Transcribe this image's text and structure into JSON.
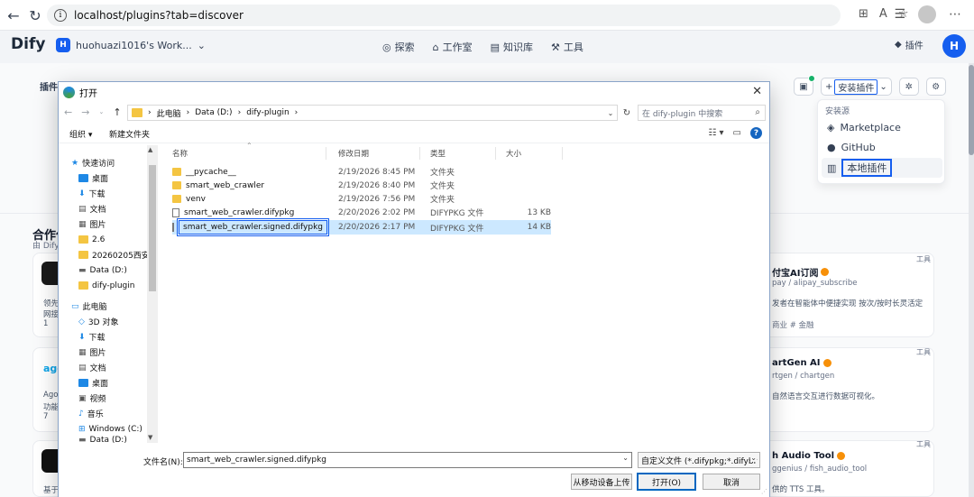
{
  "browser": {
    "url": "localhost/plugins?tab=discover"
  },
  "app": {
    "logo": "Dify",
    "workspace_badge": "H",
    "workspace_name": "huohuazi1016's Work...",
    "nav": [
      "探索",
      "工作室",
      "知识库",
      "工具"
    ],
    "plugins_label": "插件",
    "user_initial": "H"
  },
  "background_page": {
    "tab_label_partial": "插件",
    "install_button_label": "安装插件",
    "install_menu": {
      "header": "安装源",
      "items": [
        "Marketplace",
        "GitHub",
        "本地插件"
      ]
    },
    "section_title": "合作伙",
    "section_sub": "由 Dify",
    "cards_right": [
      {
        "title": "付宝AI订阅",
        "sub": "pay / alipay_subscribe",
        "desc": "发者在智能体中便捷实现 按次/按时长灵活定",
        "tags": "商业  # 金融",
        "tag": "工具"
      },
      {
        "title": "artGen AI",
        "sub": "rtgen / chartgen",
        "desc": "自然语言交互进行数据可视化。",
        "tags": "",
        "tag": "工具"
      },
      {
        "title": "h Audio Tool",
        "sub": "ggenius / fish_audio_tool",
        "desc": "供的 TTS 工具。",
        "tags": "",
        "tag": "工具"
      }
    ],
    "cards_left": [
      {
        "desc1": "领先",
        "desc2": "网接",
        "meta": "1"
      },
      {
        "logo_text": "ago",
        "desc1": "Ago",
        "desc2": "功能",
        "meta": "7"
      },
      {
        "desc1": "基于"
      }
    ]
  },
  "dialog": {
    "title": "打开",
    "breadcrumb": [
      "此电脑",
      "Data (D:)",
      "dify-plugin"
    ],
    "search_placeholder": "在 dify-plugin 中搜索",
    "organize": "组织 ▾",
    "new_folder": "新建文件夹",
    "nav_items": [
      {
        "label": "快速访问",
        "icon": "star",
        "pinned": false
      },
      {
        "label": "桌面",
        "icon": "desktop",
        "pinned": true
      },
      {
        "label": "下载",
        "icon": "download",
        "pinned": true
      },
      {
        "label": "文档",
        "icon": "document",
        "pinned": true
      },
      {
        "label": "图片",
        "icon": "picture",
        "pinned": true
      },
      {
        "label": "2.6",
        "icon": "folder",
        "pinned": false
      },
      {
        "label": "20260205西安§",
        "icon": "folder",
        "pinned": false
      },
      {
        "label": "Data (D:)",
        "icon": "drive",
        "pinned": false
      },
      {
        "label": "dify-plugin",
        "icon": "folder",
        "pinned": false
      },
      {
        "label": "此电脑",
        "icon": "pc",
        "pinned": false
      },
      {
        "label": "3D 对象",
        "icon": "3d",
        "pinned": false
      },
      {
        "label": "下载",
        "icon": "download",
        "pinned": false
      },
      {
        "label": "图片",
        "icon": "picture",
        "pinned": false
      },
      {
        "label": "文档",
        "icon": "document",
        "pinned": false
      },
      {
        "label": "桌面",
        "icon": "desktop",
        "pinned": false
      },
      {
        "label": "视频",
        "icon": "video",
        "pinned": false
      },
      {
        "label": "音乐",
        "icon": "music",
        "pinned": false
      },
      {
        "label": "Windows (C:)",
        "icon": "drive",
        "pinned": false
      },
      {
        "label": "Data (D:)",
        "icon": "drive",
        "pinned": false
      }
    ],
    "columns": [
      "名称",
      "修改日期",
      "类型",
      "大小"
    ],
    "files": [
      {
        "name": "__pycache__",
        "date": "2/19/2026 8:45 PM",
        "type": "文件夹",
        "size": "",
        "kind": "folder"
      },
      {
        "name": "smart_web_crawler",
        "date": "2/19/2026 8:40 PM",
        "type": "文件夹",
        "size": "",
        "kind": "folder"
      },
      {
        "name": "venv",
        "date": "2/19/2026 7:56 PM",
        "type": "文件夹",
        "size": "",
        "kind": "folder"
      },
      {
        "name": "smart_web_crawler.difypkg",
        "date": "2/20/2026 2:02 PM",
        "type": "DIFYPKG 文件",
        "size": "13 KB",
        "kind": "file"
      },
      {
        "name": "smart_web_crawler.signed.difypkg",
        "date": "2/20/2026 2:17 PM",
        "type": "DIFYPKG 文件",
        "size": "14 KB",
        "kind": "file",
        "selected": true
      }
    ],
    "filename_label": "文件名(N):",
    "filename_value": "smart_web_crawler.signed.difypkg",
    "filetype_value": "自定义文件 (*.difypkg;*.difybr",
    "btn_mobile": "从移动设备上传",
    "btn_open": "打开(O)",
    "btn_cancel": "取消"
  },
  "colors": {
    "accent": "#155eef",
    "selection": "#cce8ff"
  }
}
